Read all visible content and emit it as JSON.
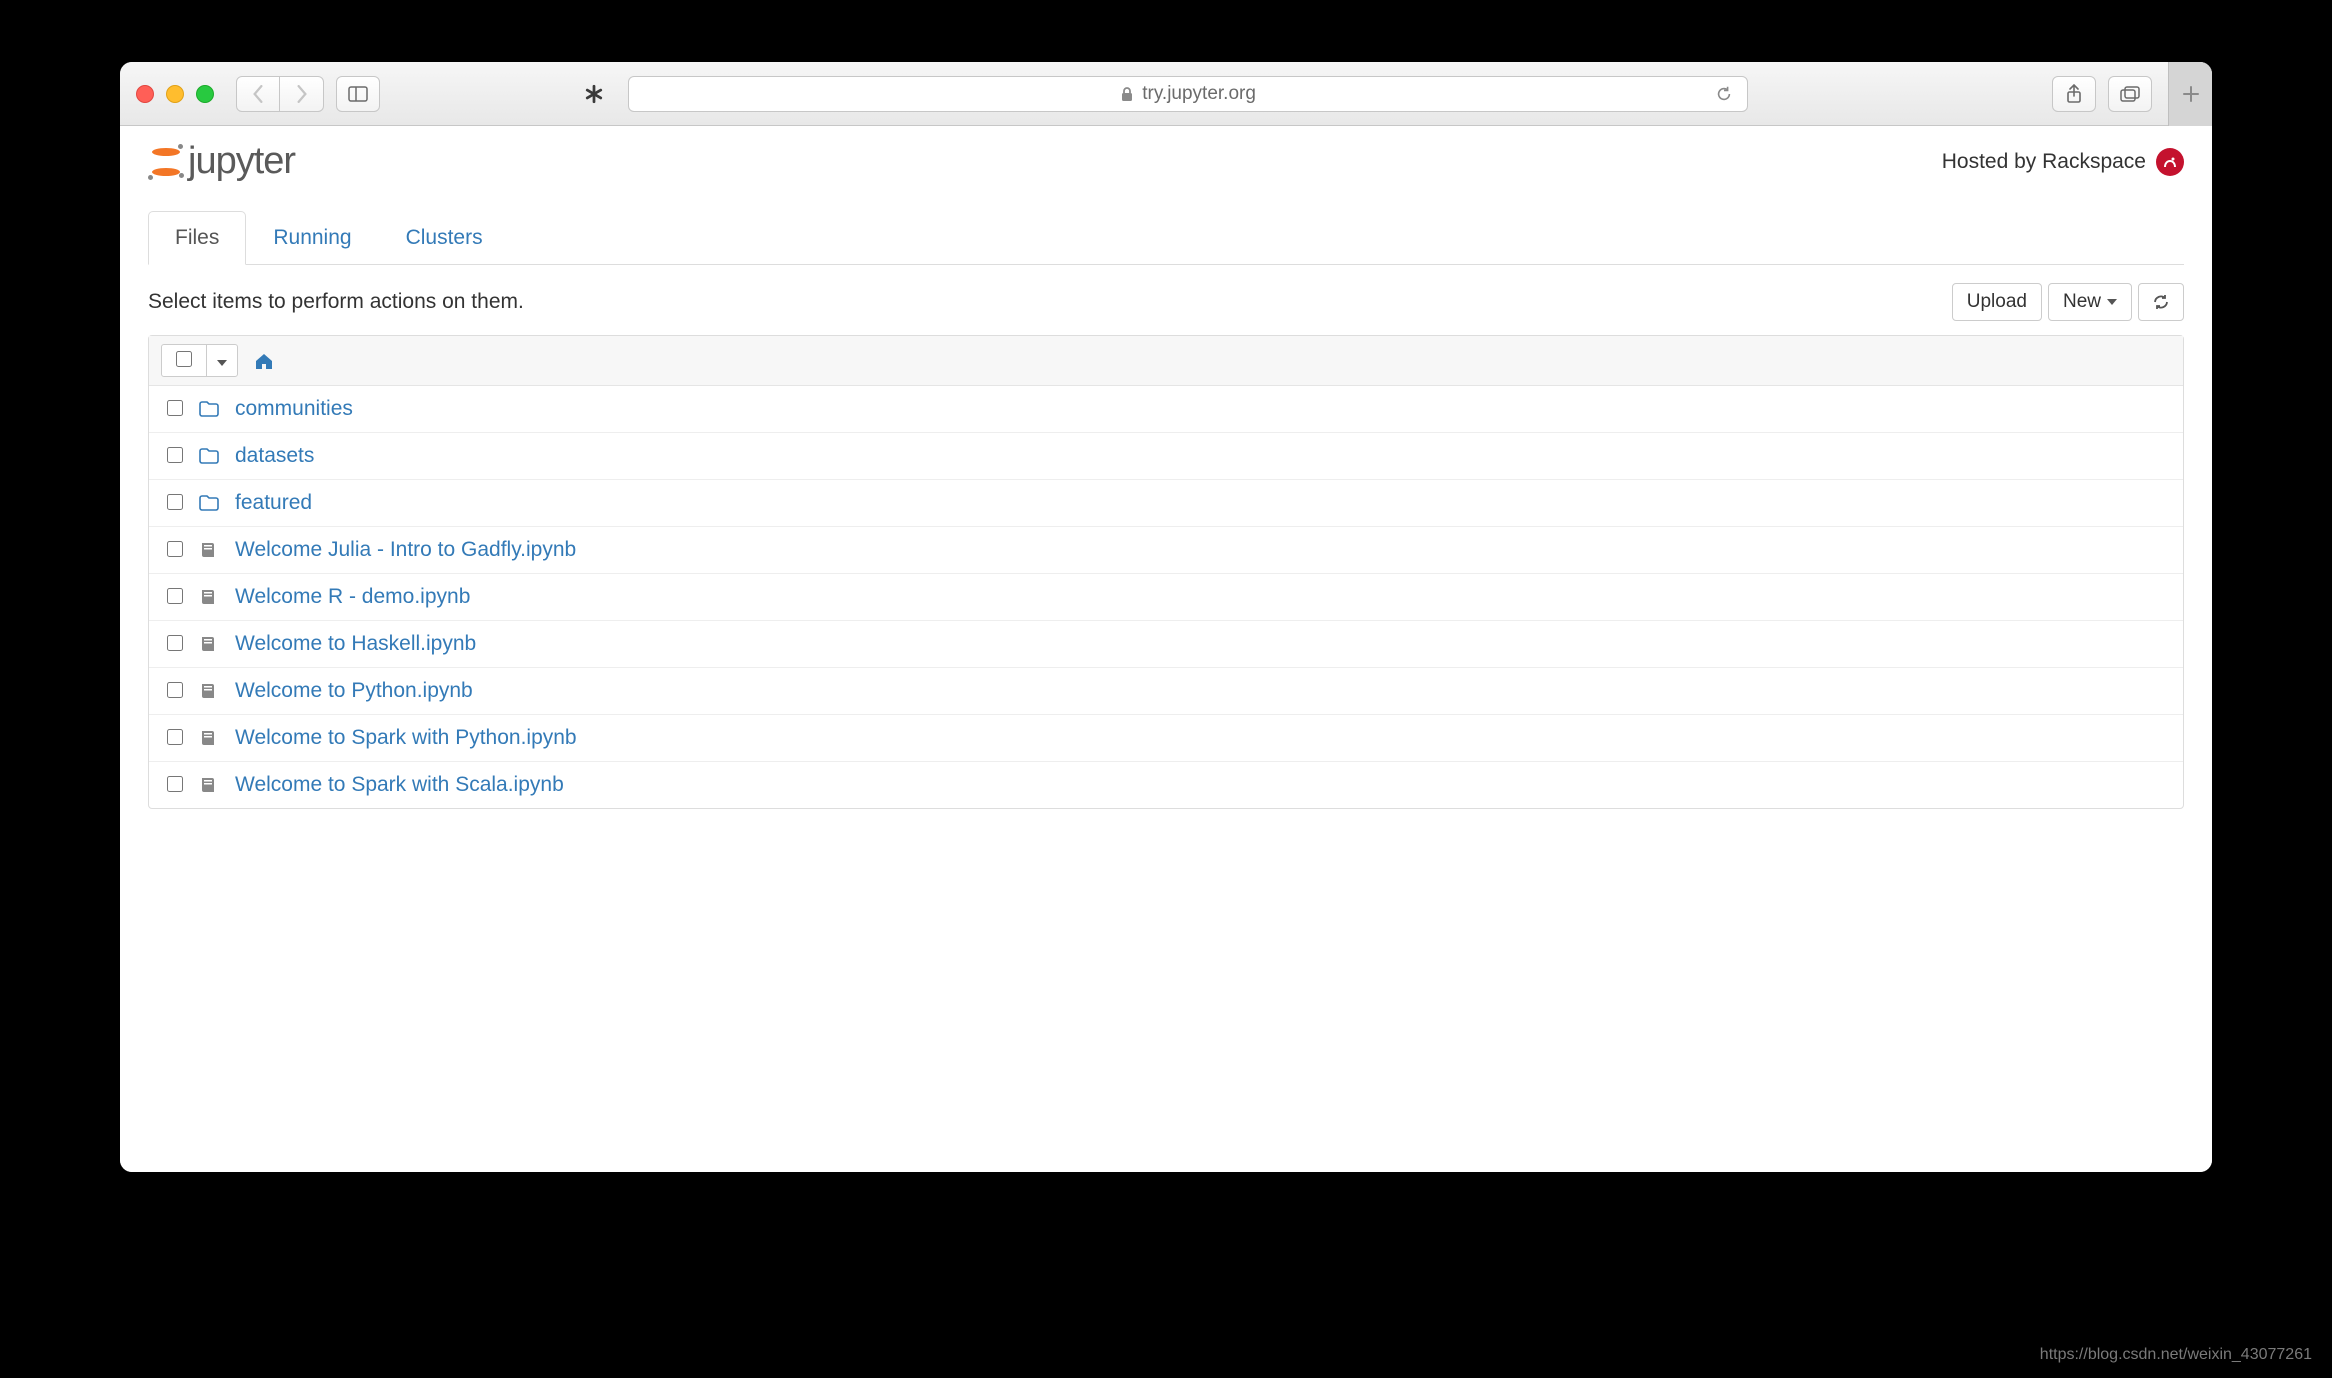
{
  "browser": {
    "url_display": "try.jupyter.org"
  },
  "header": {
    "logo_text": "jupyter",
    "hosted_by": "Hosted by Rackspace"
  },
  "tabs": {
    "files": "Files",
    "running": "Running",
    "clusters": "Clusters"
  },
  "toolbar": {
    "hint": "Select items to perform actions on them.",
    "upload": "Upload",
    "new": "New"
  },
  "items": [
    {
      "type": "folder",
      "name": "communities"
    },
    {
      "type": "folder",
      "name": "datasets"
    },
    {
      "type": "folder",
      "name": "featured"
    },
    {
      "type": "notebook",
      "name": "Welcome Julia - Intro to Gadfly.ipynb"
    },
    {
      "type": "notebook",
      "name": "Welcome R - demo.ipynb"
    },
    {
      "type": "notebook",
      "name": "Welcome to Haskell.ipynb"
    },
    {
      "type": "notebook",
      "name": "Welcome to Python.ipynb"
    },
    {
      "type": "notebook",
      "name": "Welcome to Spark with Python.ipynb"
    },
    {
      "type": "notebook",
      "name": "Welcome to Spark with Scala.ipynb"
    }
  ],
  "watermark": "https://blog.csdn.net/weixin_43077261"
}
